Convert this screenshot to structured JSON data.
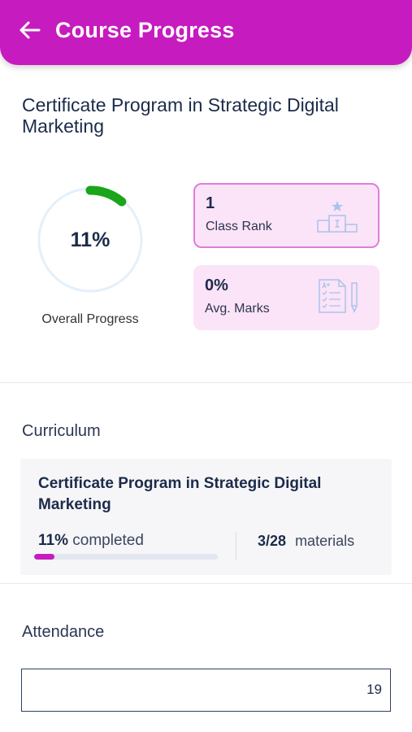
{
  "header": {
    "title": "Course Progress",
    "back_icon": "arrow-left-icon",
    "bg_color": "#c61cbf"
  },
  "course": {
    "title": "Certificate Program in Strategic Digital Marketing"
  },
  "overall": {
    "value_text": "11%",
    "progress": 0.11,
    "label": "Overall Progress",
    "ring_color": "#1aa51a"
  },
  "stats": [
    {
      "value": "1",
      "label": "Class Rank",
      "icon": "podium-icon"
    },
    {
      "value": "0%",
      "label": "Avg. Marks",
      "icon": "exam-sheet-icon"
    }
  ],
  "curriculum": {
    "section_title": "Curriculum",
    "card_title": "Certificate Program in Strategic Digital Marketing",
    "percent": "11%",
    "percent_label": "completed",
    "progress": 0.11,
    "materials_count": "3/28",
    "materials_label": "materials"
  },
  "attendance": {
    "section_title": "Attendance",
    "value": "19"
  }
}
